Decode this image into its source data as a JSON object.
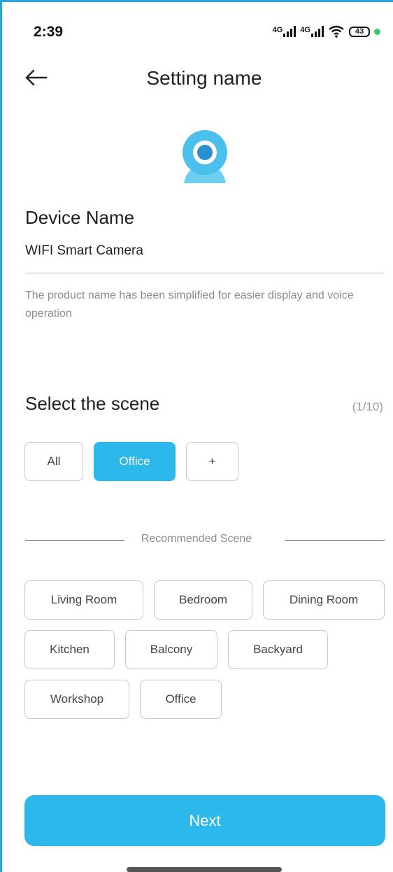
{
  "status_bar": {
    "time": "2:39",
    "network_1": "4G",
    "network_2": "4G",
    "battery": "43"
  },
  "header": {
    "title": "Setting name",
    "back_icon": "arrow-left-icon"
  },
  "device": {
    "icon": "camera-icon",
    "section_title": "Device Name",
    "name_value": "WIFI Smart Camera",
    "hint": "The product name has been simplified for easier display and voice operation"
  },
  "scene": {
    "section_title": "Select the scene",
    "counter": "(1/10)",
    "chips": [
      {
        "label": "All",
        "selected": false
      },
      {
        "label": "Office",
        "selected": true
      },
      {
        "label": "+",
        "selected": false
      }
    ]
  },
  "recommended": {
    "label": "Recommended Scene",
    "items": [
      "Living Room",
      "Bedroom",
      "Dining Room",
      "Kitchen",
      "Balcony",
      "Backyard",
      "Workshop",
      "Office"
    ]
  },
  "footer": {
    "next_label": "Next"
  },
  "colors": {
    "accent": "#2cb8ea",
    "frame": "#2aa7de"
  }
}
